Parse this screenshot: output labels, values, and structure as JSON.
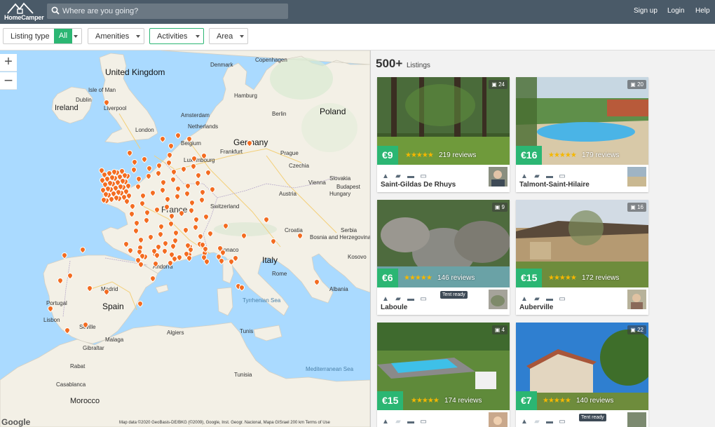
{
  "header": {
    "logo_text": "HomeCamper",
    "search_placeholder": "Where are you going?",
    "nav": {
      "signup": "Sign up",
      "login": "Login",
      "help": "Help"
    }
  },
  "filters": {
    "listing_type": "Listing type",
    "all": "All",
    "amenities": "Amenities",
    "activities": "Activities",
    "area": "Area"
  },
  "map": {
    "zoom_in": "+",
    "zoom_out": "−",
    "labels": {
      "uk": "United Kingdom",
      "ireland": "Ireland",
      "isle_of_man": "Isle of Man",
      "dublin": "Dublin",
      "liverpool": "Liverpool",
      "london": "London",
      "germany": "Germany",
      "poland": "Poland",
      "netherlands": "Netherlands",
      "amsterdam": "Amsterdam",
      "hamburg": "Hamburg",
      "berlin": "Berlin",
      "copenhagen": "Copenhagen",
      "denmark": "Denmark",
      "belgium": "Belgium",
      "luxembourg": "Luxembourg",
      "frankfurt": "Frankfurt",
      "prague": "Prague",
      "czechia": "Czechia",
      "slovakia": "Slovakia",
      "vienna": "Vienna",
      "austria": "Austria",
      "budapest": "Budapest",
      "hungary": "Hungary",
      "switzerland": "Switzerland",
      "france": "France",
      "croatia": "Croatia",
      "bosnia": "Bosnia and Herzegovina",
      "monaco": "Monaco",
      "andorra": "Andorra",
      "italy": "Italy",
      "rome": "Rome",
      "spain": "Spain",
      "madrid": "Madrid",
      "portugal": "Portugal",
      "lisbon": "Lisbon",
      "seville": "Seville",
      "malaga": "Malaga",
      "gibraltar": "Gibraltar",
      "algiers": "Algiers",
      "tunis": "Tunis",
      "tunisia": "Tunisia",
      "rabat": "Rabat",
      "casablanca": "Casablanca",
      "morocco": "Morocco",
      "albania": "Albania",
      "serbia": "Serbia",
      "kosovo": "Kosovo",
      "tyrrhenian": "Tyrrhenian Sea",
      "mediterranean": "Mediterranean Sea"
    },
    "google": "Google",
    "attribution": "Map data ©2020 GeoBasis-DE/BKG (©2009), Google, Inst. Geogr. Nacional, Mapa GISrael   200 km   Terms of Use"
  },
  "listings": {
    "count": "500+",
    "count_label": "Listings",
    "items": [
      {
        "price": "€9",
        "stars": "★★★★★",
        "reviews": "219 reviews",
        "place": "Saint-Gildas De Rhuys",
        "photos": "24",
        "tent_ready": ""
      },
      {
        "price": "€16",
        "stars": "★★★★★",
        "reviews": "179 reviews",
        "place": "Talmont-Saint-Hilaire",
        "photos": "20",
        "tent_ready": ""
      },
      {
        "price": "€6",
        "stars": "★★★★★",
        "reviews": "146 reviews",
        "place": "Laboule",
        "photos": "9",
        "tent_ready": "Tent ready"
      },
      {
        "price": "€15",
        "stars": "★★★★★",
        "reviews": "172 reviews",
        "place": "Auberville",
        "photos": "16",
        "tent_ready": ""
      },
      {
        "price": "€15",
        "stars": "★★★★★",
        "reviews": "174 reviews",
        "place": "",
        "photos": "4",
        "tent_ready": ""
      },
      {
        "price": "€7",
        "stars": "★★★★★",
        "reviews": "140 reviews",
        "place": "",
        "photos": "22",
        "tent_ready": "Tent ready"
      }
    ]
  },
  "colors": {
    "header": "#4a5a68",
    "accent": "#2bb673",
    "pin": "#f36c21",
    "sea": "#aadaff",
    "land": "#f3f0e6"
  }
}
